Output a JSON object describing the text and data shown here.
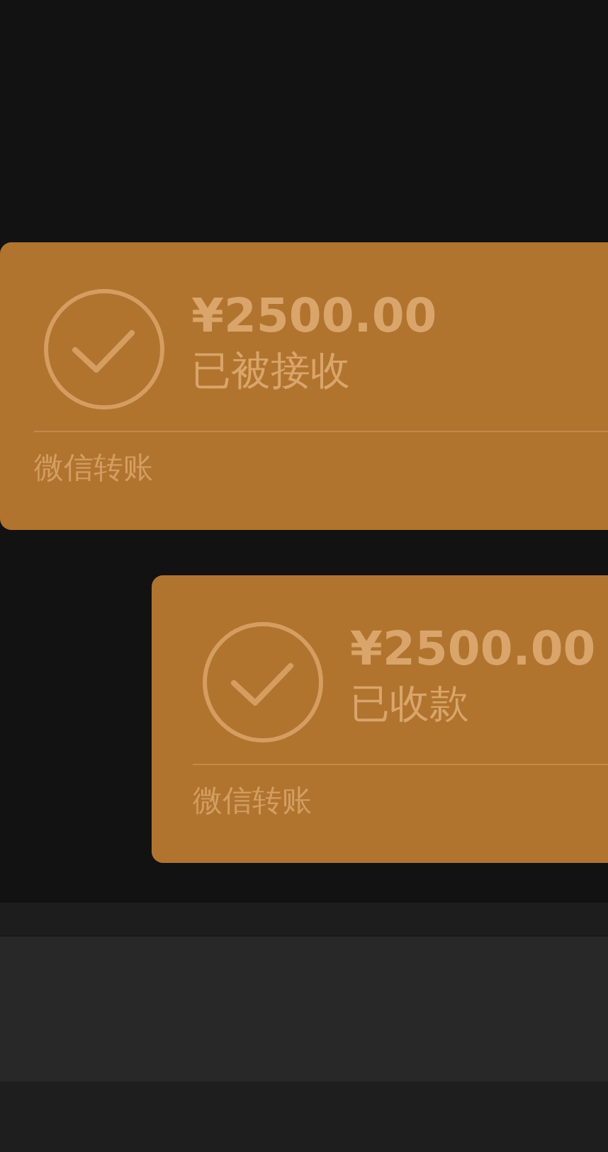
{
  "messages": [
    {
      "kind": "received",
      "amount": "¥2500.00",
      "status": "已被接收",
      "label": "微信转账"
    },
    {
      "kind": "sent",
      "amount": "¥2500.00",
      "status": "已收款",
      "label": "微信转账"
    }
  ]
}
